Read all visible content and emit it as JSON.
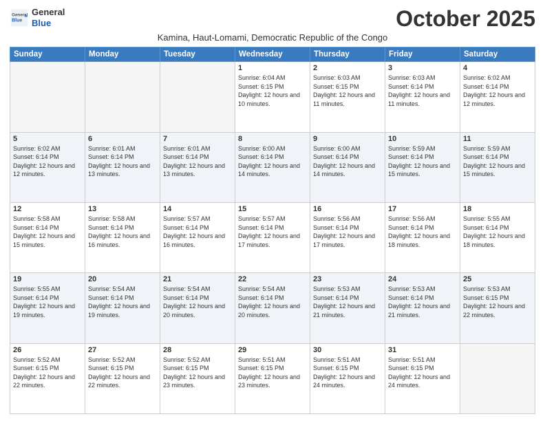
{
  "logo": {
    "general": "General",
    "blue": "Blue"
  },
  "title": "October 2025",
  "subtitle": "Kamina, Haut-Lomami, Democratic Republic of the Congo",
  "days_of_week": [
    "Sunday",
    "Monday",
    "Tuesday",
    "Wednesday",
    "Thursday",
    "Friday",
    "Saturday"
  ],
  "weeks": [
    [
      {
        "day": "",
        "sunrise": "",
        "sunset": "",
        "daylight": "",
        "empty": true
      },
      {
        "day": "",
        "sunrise": "",
        "sunset": "",
        "daylight": "",
        "empty": true
      },
      {
        "day": "",
        "sunrise": "",
        "sunset": "",
        "daylight": "",
        "empty": true
      },
      {
        "day": "1",
        "sunrise": "Sunrise: 6:04 AM",
        "sunset": "Sunset: 6:15 PM",
        "daylight": "Daylight: 12 hours and 10 minutes."
      },
      {
        "day": "2",
        "sunrise": "Sunrise: 6:03 AM",
        "sunset": "Sunset: 6:15 PM",
        "daylight": "Daylight: 12 hours and 11 minutes."
      },
      {
        "day": "3",
        "sunrise": "Sunrise: 6:03 AM",
        "sunset": "Sunset: 6:14 PM",
        "daylight": "Daylight: 12 hours and 11 minutes."
      },
      {
        "day": "4",
        "sunrise": "Sunrise: 6:02 AM",
        "sunset": "Sunset: 6:14 PM",
        "daylight": "Daylight: 12 hours and 12 minutes."
      }
    ],
    [
      {
        "day": "5",
        "sunrise": "Sunrise: 6:02 AM",
        "sunset": "Sunset: 6:14 PM",
        "daylight": "Daylight: 12 hours and 12 minutes."
      },
      {
        "day": "6",
        "sunrise": "Sunrise: 6:01 AM",
        "sunset": "Sunset: 6:14 PM",
        "daylight": "Daylight: 12 hours and 13 minutes."
      },
      {
        "day": "7",
        "sunrise": "Sunrise: 6:01 AM",
        "sunset": "Sunset: 6:14 PM",
        "daylight": "Daylight: 12 hours and 13 minutes."
      },
      {
        "day": "8",
        "sunrise": "Sunrise: 6:00 AM",
        "sunset": "Sunset: 6:14 PM",
        "daylight": "Daylight: 12 hours and 14 minutes."
      },
      {
        "day": "9",
        "sunrise": "Sunrise: 6:00 AM",
        "sunset": "Sunset: 6:14 PM",
        "daylight": "Daylight: 12 hours and 14 minutes."
      },
      {
        "day": "10",
        "sunrise": "Sunrise: 5:59 AM",
        "sunset": "Sunset: 6:14 PM",
        "daylight": "Daylight: 12 hours and 15 minutes."
      },
      {
        "day": "11",
        "sunrise": "Sunrise: 5:59 AM",
        "sunset": "Sunset: 6:14 PM",
        "daylight": "Daylight: 12 hours and 15 minutes."
      }
    ],
    [
      {
        "day": "12",
        "sunrise": "Sunrise: 5:58 AM",
        "sunset": "Sunset: 6:14 PM",
        "daylight": "Daylight: 12 hours and 15 minutes."
      },
      {
        "day": "13",
        "sunrise": "Sunrise: 5:58 AM",
        "sunset": "Sunset: 6:14 PM",
        "daylight": "Daylight: 12 hours and 16 minutes."
      },
      {
        "day": "14",
        "sunrise": "Sunrise: 5:57 AM",
        "sunset": "Sunset: 6:14 PM",
        "daylight": "Daylight: 12 hours and 16 minutes."
      },
      {
        "day": "15",
        "sunrise": "Sunrise: 5:57 AM",
        "sunset": "Sunset: 6:14 PM",
        "daylight": "Daylight: 12 hours and 17 minutes."
      },
      {
        "day": "16",
        "sunrise": "Sunrise: 5:56 AM",
        "sunset": "Sunset: 6:14 PM",
        "daylight": "Daylight: 12 hours and 17 minutes."
      },
      {
        "day": "17",
        "sunrise": "Sunrise: 5:56 AM",
        "sunset": "Sunset: 6:14 PM",
        "daylight": "Daylight: 12 hours and 18 minutes."
      },
      {
        "day": "18",
        "sunrise": "Sunrise: 5:55 AM",
        "sunset": "Sunset: 6:14 PM",
        "daylight": "Daylight: 12 hours and 18 minutes."
      }
    ],
    [
      {
        "day": "19",
        "sunrise": "Sunrise: 5:55 AM",
        "sunset": "Sunset: 6:14 PM",
        "daylight": "Daylight: 12 hours and 19 minutes."
      },
      {
        "day": "20",
        "sunrise": "Sunrise: 5:54 AM",
        "sunset": "Sunset: 6:14 PM",
        "daylight": "Daylight: 12 hours and 19 minutes."
      },
      {
        "day": "21",
        "sunrise": "Sunrise: 5:54 AM",
        "sunset": "Sunset: 6:14 PM",
        "daylight": "Daylight: 12 hours and 20 minutes."
      },
      {
        "day": "22",
        "sunrise": "Sunrise: 5:54 AM",
        "sunset": "Sunset: 6:14 PM",
        "daylight": "Daylight: 12 hours and 20 minutes."
      },
      {
        "day": "23",
        "sunrise": "Sunrise: 5:53 AM",
        "sunset": "Sunset: 6:14 PM",
        "daylight": "Daylight: 12 hours and 21 minutes."
      },
      {
        "day": "24",
        "sunrise": "Sunrise: 5:53 AM",
        "sunset": "Sunset: 6:14 PM",
        "daylight": "Daylight: 12 hours and 21 minutes."
      },
      {
        "day": "25",
        "sunrise": "Sunrise: 5:53 AM",
        "sunset": "Sunset: 6:15 PM",
        "daylight": "Daylight: 12 hours and 22 minutes."
      }
    ],
    [
      {
        "day": "26",
        "sunrise": "Sunrise: 5:52 AM",
        "sunset": "Sunset: 6:15 PM",
        "daylight": "Daylight: 12 hours and 22 minutes."
      },
      {
        "day": "27",
        "sunrise": "Sunrise: 5:52 AM",
        "sunset": "Sunset: 6:15 PM",
        "daylight": "Daylight: 12 hours and 22 minutes."
      },
      {
        "day": "28",
        "sunrise": "Sunrise: 5:52 AM",
        "sunset": "Sunset: 6:15 PM",
        "daylight": "Daylight: 12 hours and 23 minutes."
      },
      {
        "day": "29",
        "sunrise": "Sunrise: 5:51 AM",
        "sunset": "Sunset: 6:15 PM",
        "daylight": "Daylight: 12 hours and 23 minutes."
      },
      {
        "day": "30",
        "sunrise": "Sunrise: 5:51 AM",
        "sunset": "Sunset: 6:15 PM",
        "daylight": "Daylight: 12 hours and 24 minutes."
      },
      {
        "day": "31",
        "sunrise": "Sunrise: 5:51 AM",
        "sunset": "Sunset: 6:15 PM",
        "daylight": "Daylight: 12 hours and 24 minutes."
      },
      {
        "day": "",
        "sunrise": "",
        "sunset": "",
        "daylight": "",
        "empty": true
      }
    ]
  ]
}
